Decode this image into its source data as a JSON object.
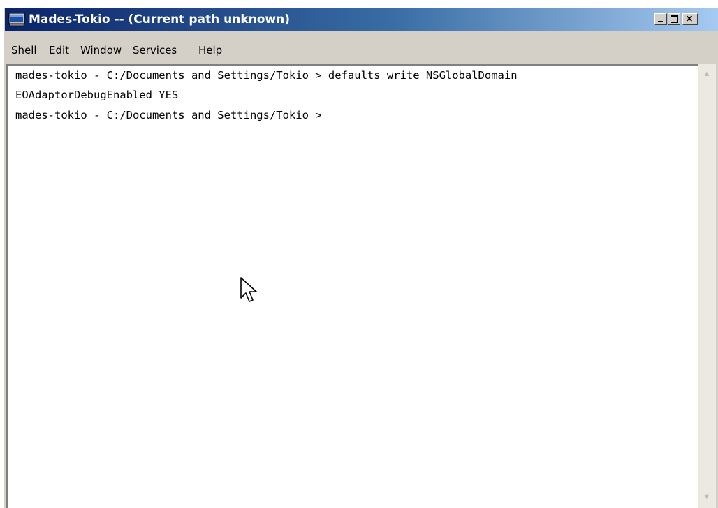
{
  "window": {
    "title": "Mades-Tokio -- (Current path unknown)",
    "icon": "terminal-app-icon",
    "controls": {
      "minimize": "minimize-icon",
      "maximize": "maximize-icon",
      "close": "×"
    }
  },
  "menubar": {
    "items": [
      {
        "label": "Shell"
      },
      {
        "label": "Edit"
      },
      {
        "label": "Window"
      },
      {
        "label": "Services"
      },
      {
        "label": "Help"
      }
    ]
  },
  "terminal": {
    "lines": [
      "mades-tokio - C:/Documents and Settings/Tokio > defaults write NSGlobalDomain",
      "EOAdaptorDebugEnabled YES",
      "mades-tokio - C:/Documents and Settings/Tokio >"
    ]
  },
  "scrollbar": {
    "up_icon": "scroll-up-arrow-icon",
    "down_icon": "scroll-down-arrow-icon"
  },
  "pointer": {
    "icon": "mouse-pointer-icon"
  },
  "colors": {
    "titlebar_start": "#0a246a",
    "titlebar_end": "#a6caf0",
    "chrome": "#d4d0c8",
    "terminal_bg": "#ffffff",
    "terminal_text": "#000000"
  }
}
